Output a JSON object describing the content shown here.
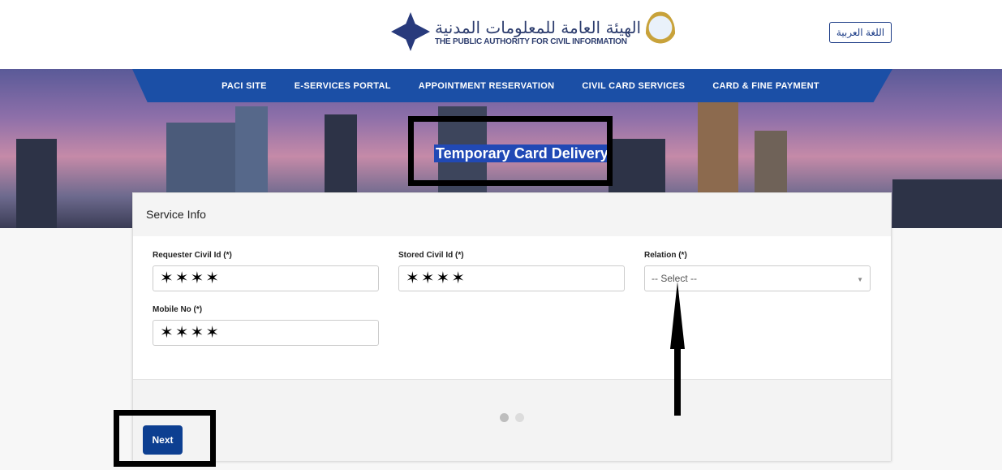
{
  "header": {
    "logo_ar": "الهيئة العامة للمعلومات المدنية",
    "logo_en": "THE PUBLIC AUTHORITY FOR CIVIL INFORMATION",
    "lang_button": "اللغة العربية"
  },
  "nav": {
    "items": [
      "PACI SITE",
      "E-SERVICES PORTAL",
      "APPOINTMENT RESERVATION",
      "CIVIL CARD SERVICES",
      "CARD & FINE PAYMENT"
    ]
  },
  "banner": {
    "title": "Temporary Card Delivery"
  },
  "form": {
    "section_title": "Service Info",
    "requester_label": "Requester Civil Id (*)",
    "requester_value": "✶✶✶✶",
    "stored_label": "Stored Civil Id (*)",
    "stored_value": "✶✶✶✶",
    "relation_label": "Relation (*)",
    "relation_value": "-- Select --",
    "mobile_label": "Mobile No (*)",
    "mobile_value": "✶✶✶✶"
  },
  "footer": {
    "next_label": "Next",
    "pager_active": 1,
    "pager_total": 2
  },
  "colors": {
    "nav": "#1b4fa6",
    "button": "#0d3f91"
  }
}
